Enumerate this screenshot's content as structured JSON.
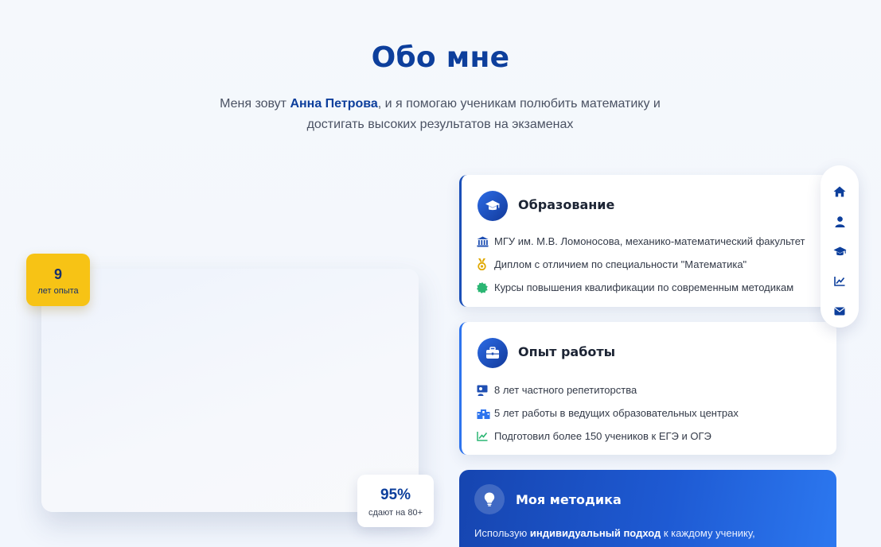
{
  "header": {
    "title": "Обо мне",
    "intro_prefix": "Меня зовут ",
    "intro_name": "Анна Петрова",
    "intro_line1_suffix": ", и я помогаю ученикам полюбить математику и",
    "intro_line2": "достигать высоких результатов на экзаменах"
  },
  "photo": {
    "experience_badge": {
      "value": "9",
      "label": "лет опыта"
    },
    "result_badge": {
      "value": "95%",
      "label": "сдают на 80+"
    }
  },
  "education": {
    "icon": "graduation-cap-icon",
    "title": "Образование",
    "items": [
      {
        "icon": "university-icon",
        "text": "МГУ им. М.В. Ломоносова, механико-математический факультет"
      },
      {
        "icon": "medal-icon",
        "text": "Диплом с отличием по специальности \"Математика\""
      },
      {
        "icon": "certificate-icon",
        "text": "Курсы повышения квалификации по современным методикам"
      }
    ]
  },
  "work": {
    "icon": "briefcase-icon",
    "title": "Опыт работы",
    "items": [
      {
        "icon": "teacher-icon",
        "text": "8 лет частного репетиторства"
      },
      {
        "icon": "school-building-icon",
        "text": "5 лет работы в ведущих образовательных центрах"
      },
      {
        "icon": "chart-line-icon",
        "text": "Подготовил более 150 учеников к ЕГЭ и ОГЭ"
      }
    ]
  },
  "method": {
    "icon": "lightbulb-icon",
    "title": "Моя методика",
    "text_prefix": "Использую ",
    "text_bold": "индивидуальный подход",
    "text_suffix": " к каждому ученику,"
  },
  "side_nav": {
    "items": [
      "home-icon",
      "user-icon",
      "graduation-cap-icon",
      "chart-line-icon",
      "envelope-icon"
    ]
  },
  "colors": {
    "primary": "#0d3f9c",
    "accent_yellow": "#f7c315",
    "green": "#2bb673",
    "gold": "#e0a800"
  }
}
